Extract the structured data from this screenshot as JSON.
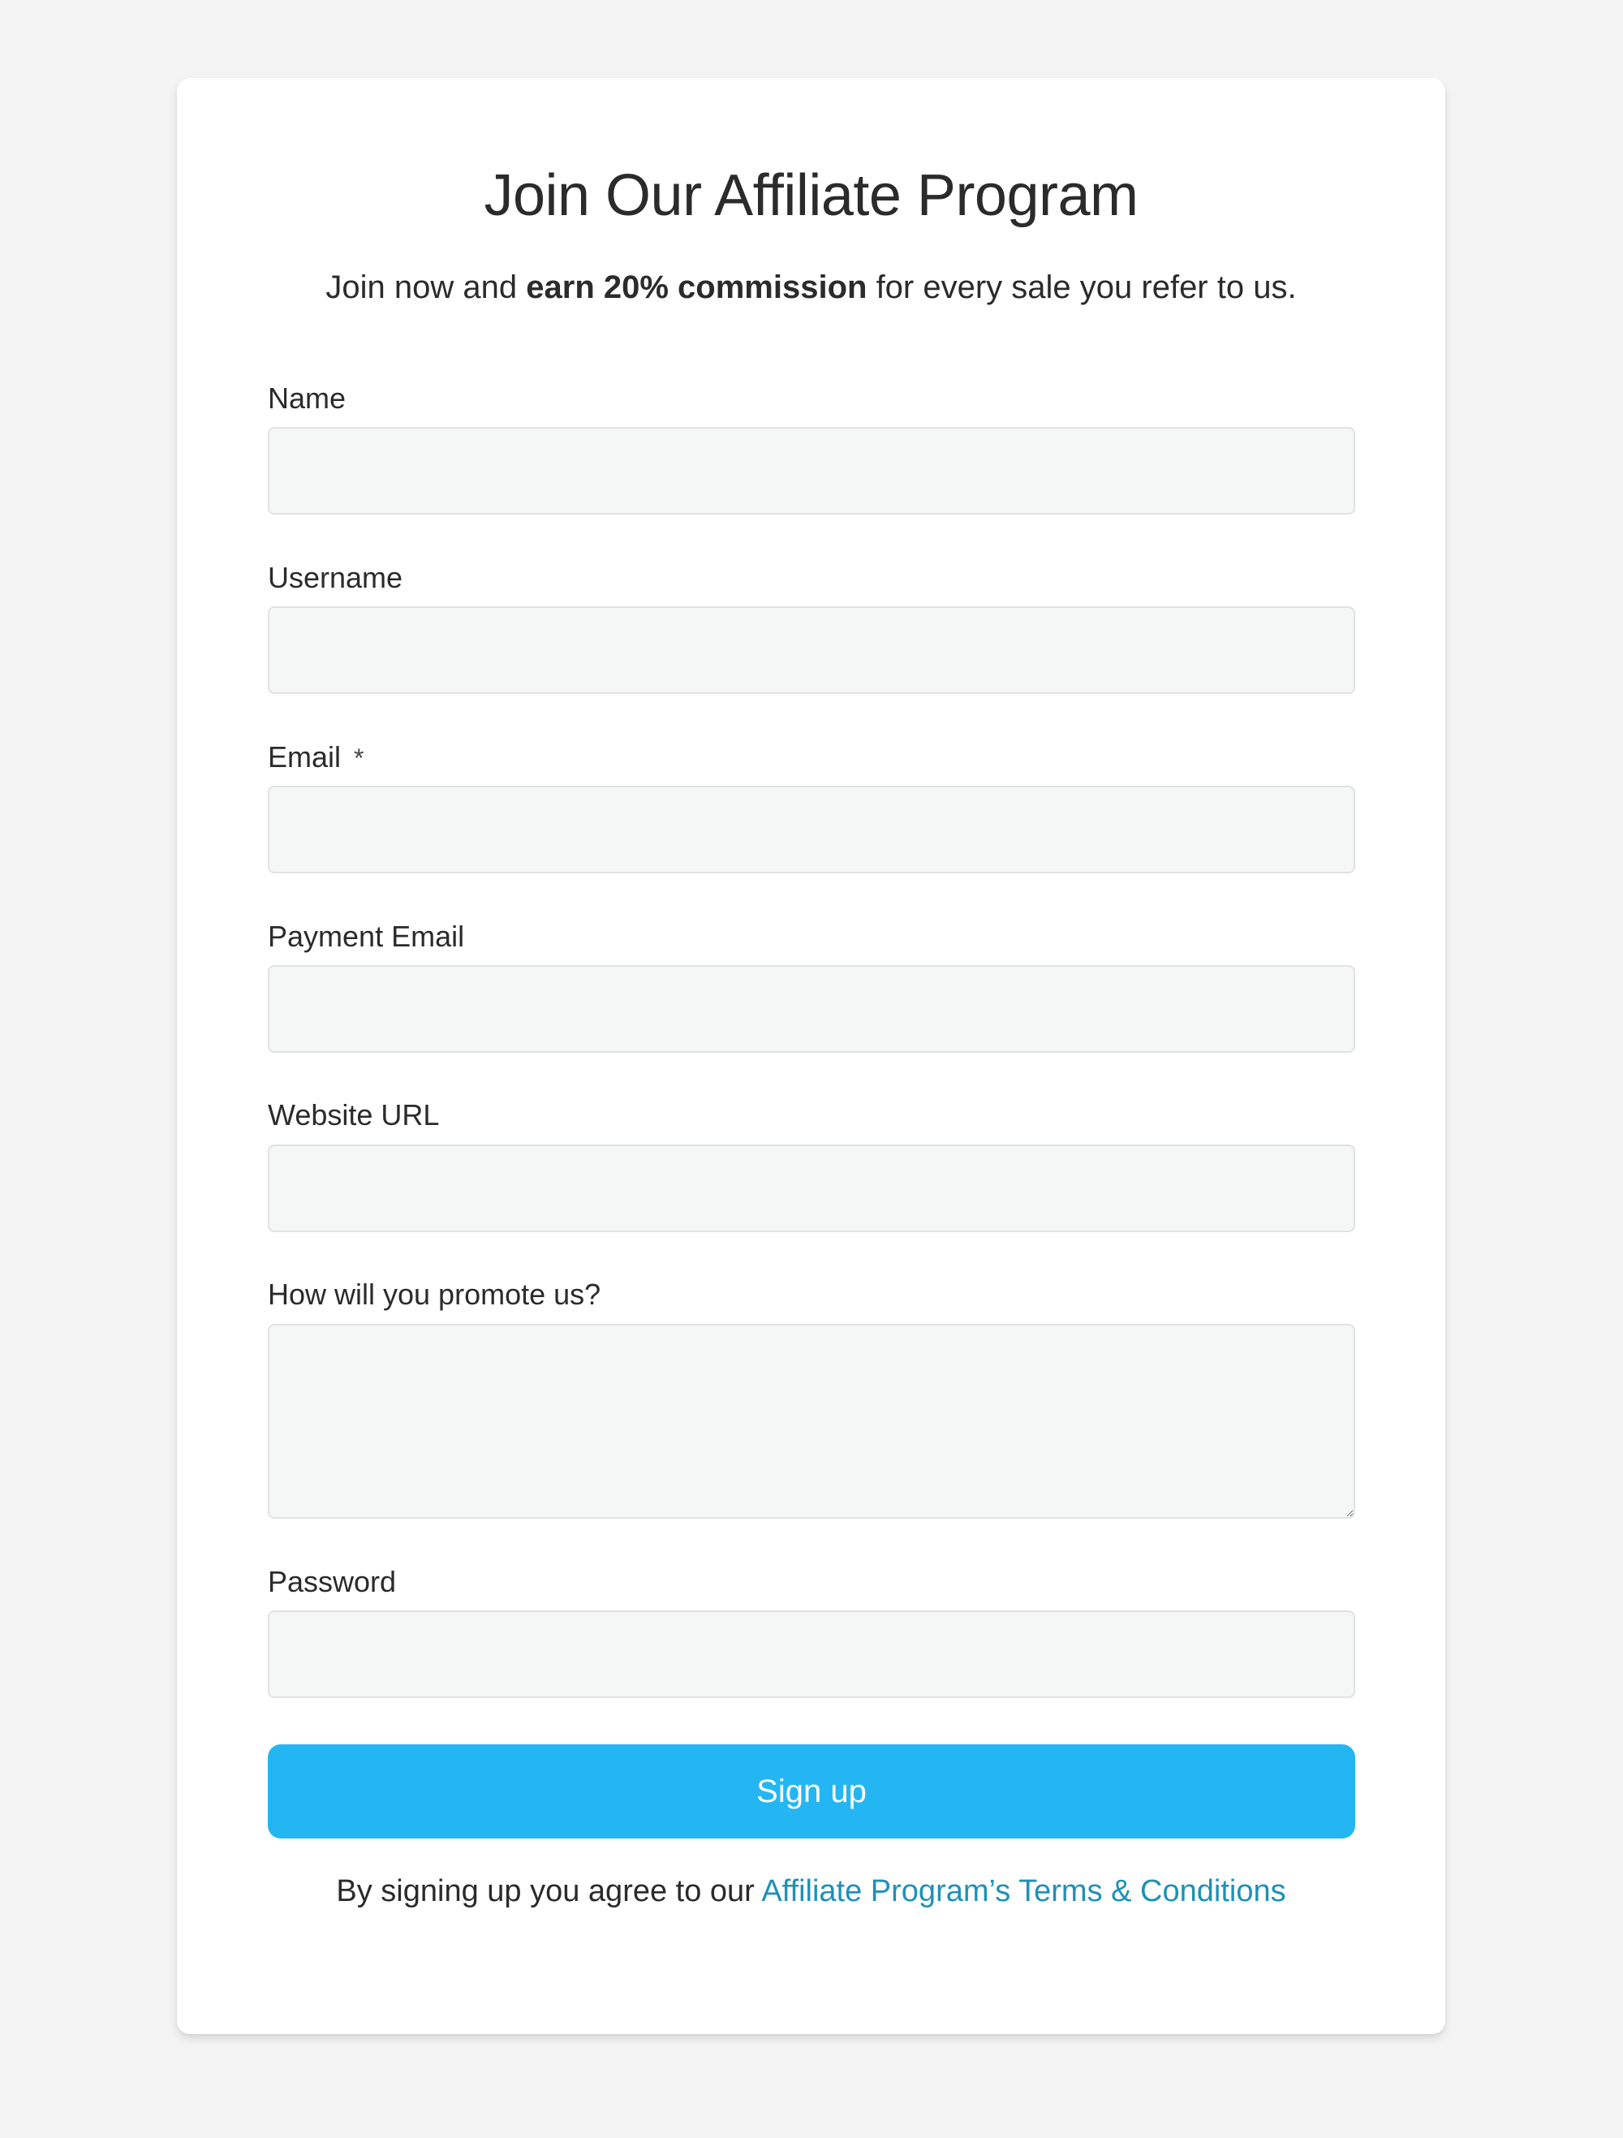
{
  "form": {
    "title": "Join Our Affiliate Program",
    "subtitle": {
      "prefix": "Join now and ",
      "highlight": "earn 20% commission",
      "suffix": " for every sale you refer to us."
    },
    "fields": [
      {
        "label": "Name",
        "value": "",
        "placeholder": "",
        "required": false
      },
      {
        "label": "Username",
        "value": "",
        "placeholder": "",
        "required": false
      },
      {
        "label": "Email",
        "value": "",
        "placeholder": "",
        "required": true,
        "required_marker": "*"
      },
      {
        "label": "Payment Email",
        "value": "",
        "placeholder": "",
        "required": false
      },
      {
        "label": "Website URL",
        "value": "",
        "placeholder": "",
        "required": false
      },
      {
        "label": "How will you promote us?",
        "value": "",
        "placeholder": "",
        "required": false,
        "multiline": true
      },
      {
        "label": "Password",
        "value": "",
        "placeholder": "",
        "required": false
      }
    ],
    "submit_label": "Sign up",
    "terms": {
      "prefix": "By signing up you agree to our ",
      "link_text": "Affiliate Program’s Terms & Conditions"
    }
  },
  "colors": {
    "page_background": "#f4f4f4",
    "card_background": "#ffffff",
    "input_background": "#f5f6f6",
    "button": "#24b6f2",
    "link": "#1e90b8",
    "text": "#2b2b2b"
  }
}
